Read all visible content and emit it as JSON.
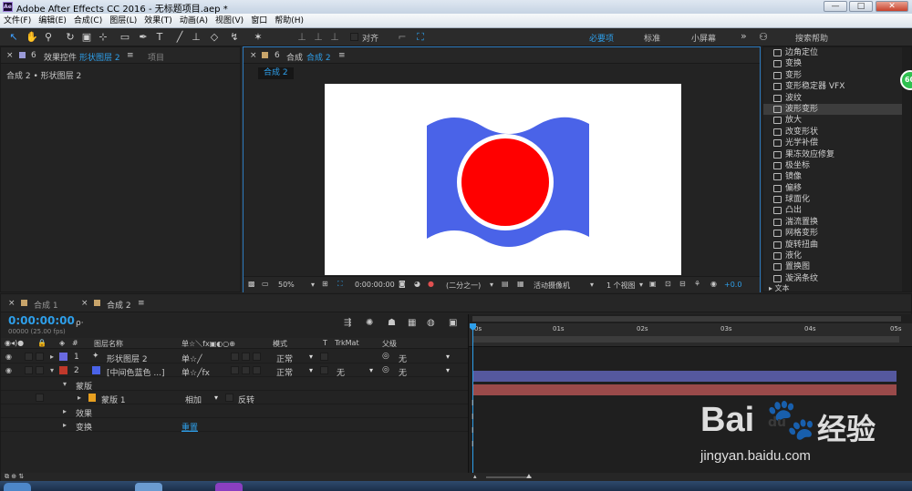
{
  "titlebar": {
    "logo": "Ae",
    "title": "Adobe After Effects CC 2016 - 无标题项目.aep *",
    "btn_min": "—",
    "btn_max": "□",
    "btn_close": "✕"
  },
  "menus": [
    "文件(F)",
    "编辑(E)",
    "合成(C)",
    "图层(L)",
    "效果(T)",
    "动画(A)",
    "视图(V)",
    "窗口",
    "帮助(H)"
  ],
  "toolbar": {
    "align_label": "对齐",
    "workspace_essentials": "必要项",
    "workspace_standard": "标准",
    "workspace_small": "小屏幕",
    "more": "»",
    "search_help": "搜索帮助"
  },
  "effects_panel": {
    "close": "×",
    "tab_label": "效果控件",
    "tab_layer": "形状图层 2",
    "tab_menu": "≡",
    "tab_project": "项目",
    "breadcrumb": "合成 2 • 形状图层 2"
  },
  "comp_panel": {
    "close": "×",
    "tab_label": "合成",
    "tab_comp": "合成 2",
    "tab_menu": "≡",
    "subtab": "合成 2",
    "footer": {
      "zoom": "50%",
      "timecode": "0:00:00:00",
      "resolution": "(二分之一)",
      "camera": "活动摄像机",
      "views": "1 个视图",
      "exposure": "+0.0"
    }
  },
  "effects_list": {
    "items": [
      "边角定位",
      "变换",
      "变形",
      "变形稳定器 VFX",
      "波纹",
      "波形变形",
      "放大",
      "改变形状",
      "光学补偿",
      "果冻效应修复",
      "极坐标",
      "镜像",
      "偏移",
      "球面化",
      "凸出",
      "湍流置换",
      "网格变形",
      "旋转扭曲",
      "液化",
      "置换图",
      "漩涡条纹"
    ],
    "selected_index": 5,
    "bottom": "▸ 文本"
  },
  "timeline": {
    "tabs": [
      {
        "close": "×",
        "label": "合成 1"
      },
      {
        "close": "×",
        "label": "合成 2",
        "menu": "≡"
      }
    ],
    "timecode": "0:00:00:00",
    "fps": "00000 (25.00 fps)",
    "search": "ρ·",
    "headers": {
      "num": "#",
      "layer_name": "图层名称",
      "switches": "单☆＼fx▣◐○⊕",
      "mode": "模式",
      "t": "T",
      "trkmat": "TrkMat",
      "parent": "父级"
    },
    "layers": [
      {
        "num": "1",
        "name": "形状图层 2",
        "mode": "正常",
        "trkmat": "",
        "parent": "无",
        "color": "#6a6ae0"
      },
      {
        "num": "2",
        "name": "[中间色蓝色 ...]",
        "mode": "正常",
        "trkmat": "无",
        "parent": "无",
        "color": "#c0392b"
      }
    ],
    "sub": {
      "masks": "蒙版",
      "mask1": "蒙版 1",
      "mask_mode": "相加",
      "invert": "反转",
      "effects": "效果",
      "transform": "变换",
      "reset": "重置"
    },
    "ruler": [
      "0s",
      "01s",
      "02s",
      "03s",
      "04s",
      "05s"
    ],
    "track_colors": [
      "#55589e",
      "#9a4a4a"
    ]
  },
  "watermark": {
    "brand": "Bai",
    "paw": "du",
    "cn": "经验",
    "url": "jingyan.baidu.com"
  },
  "badge": "60",
  "comp_colors": {
    "wave": "#4a63e8",
    "circle": "#ff0000",
    "ring": "#ffffff",
    "bg": "#ffffff"
  }
}
